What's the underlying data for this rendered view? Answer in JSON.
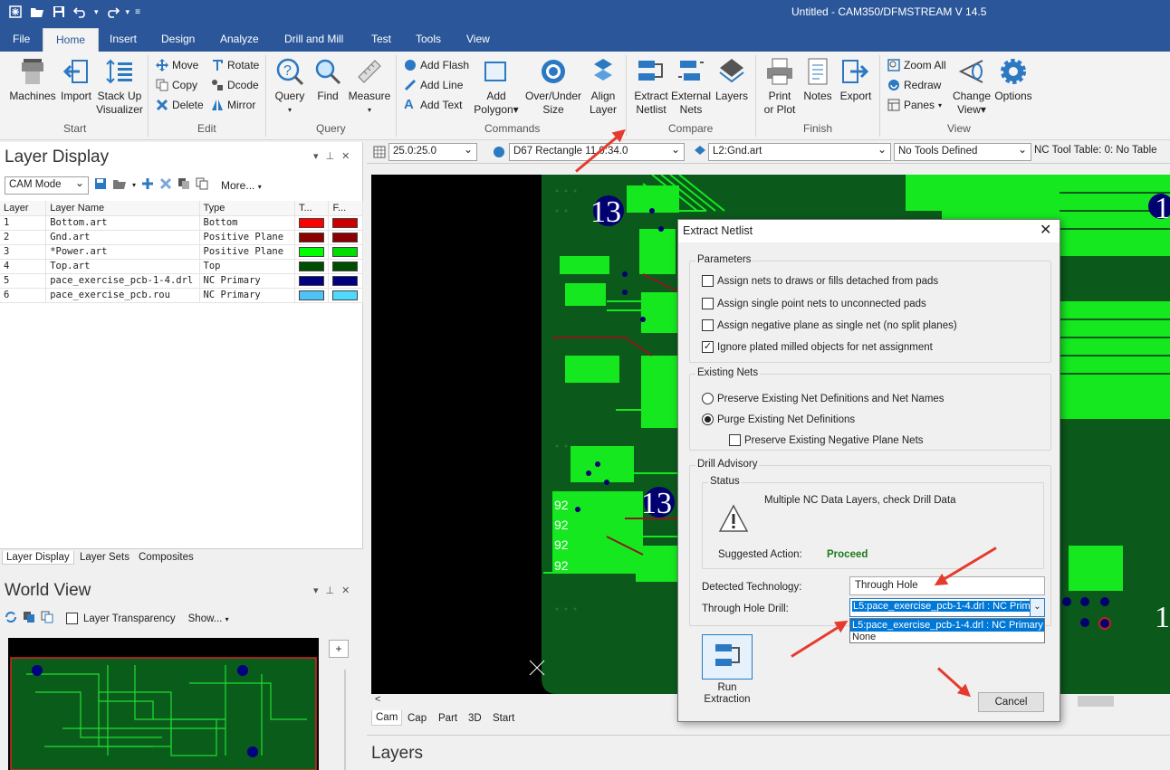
{
  "window": {
    "title": "Untitled - CAM350/DFMSTREAM V 14.5"
  },
  "menu": {
    "tabs": [
      "File",
      "Home",
      "Insert",
      "Design",
      "Analyze",
      "Drill and Mill",
      "Test",
      "Tools",
      "View"
    ],
    "active": "Home"
  },
  "ribbon": {
    "start": {
      "group": "Start",
      "machines": "Machines",
      "import": "Import",
      "stackup_1": "Stack Up",
      "stackup_2": "Visualizer"
    },
    "edit": {
      "group": "Edit",
      "move": "Move",
      "rotate": "Rotate",
      "copy": "Copy",
      "dcode": "Dcode",
      "delete": "Delete",
      "mirror": "Mirror"
    },
    "query": {
      "group": "Query",
      "query": "Query",
      "find": "Find",
      "measure": "Measure"
    },
    "commands": {
      "group": "Commands",
      "add_flash": "Add Flash",
      "add_line": "Add Line",
      "add_text": "Add Text",
      "add_polygon_1": "Add",
      "add_polygon_2": "Polygon",
      "over_under_1": "Over/Under",
      "over_under_2": "Size",
      "align_1": "Align",
      "align_2": "Layer"
    },
    "compare": {
      "group": "Compare",
      "extract_1": "Extract",
      "extract_2": "Netlist",
      "external_1": "External",
      "external_2": "Nets",
      "layers": "Layers"
    },
    "finish": {
      "group": "Finish",
      "print_1": "Print",
      "print_2": "or Plot",
      "notes": "Notes",
      "export": "Export"
    },
    "view": {
      "group": "View",
      "zoom_all": "Zoom All",
      "redraw": "Redraw",
      "panes": "Panes",
      "change_view_1": "Change",
      "change_view_2": "View",
      "options": "Options"
    }
  },
  "layer_display": {
    "title": "Layer Display",
    "mode": "CAM Mode",
    "more": "More...",
    "columns": [
      "Layer",
      "Layer Name",
      "Type",
      "T...",
      "F..."
    ],
    "rows": [
      {
        "num": "1",
        "name": "Bottom.art",
        "type": "Bottom",
        "t": "#ff0000",
        "f": "#cc0000"
      },
      {
        "num": "2",
        "name": "Gnd.art",
        "type": "Positive Plane",
        "t": "#8b0000",
        "f": "#8b0000"
      },
      {
        "num": "3",
        "name": "*Power.art",
        "type": "Positive Plane",
        "t": "#00ff00",
        "f": "#00dd00"
      },
      {
        "num": "4",
        "name": "Top.art",
        "type": "Top",
        "t": "#004d00",
        "f": "#004d00"
      },
      {
        "num": "5",
        "name": "pace_exercise_pcb-1-4.drl",
        "type": "NC Primary",
        "t": "#000080",
        "f": "#000080"
      },
      {
        "num": "6",
        "name": "pace_exercise_pcb.rou",
        "type": "NC Primary",
        "t": "#4fc3f7",
        "f": "#4fd9ff"
      }
    ],
    "tabs": [
      "Layer Display",
      "Layer Sets",
      "Composites"
    ]
  },
  "world_view": {
    "title": "World View",
    "transparency": "Layer Transparency",
    "show": "Show..."
  },
  "layers_panel": {
    "title": "Layers"
  },
  "toolbar": {
    "grid": "25.0:25.0",
    "dcode": "D67   Rectangle 11.0:34.0",
    "layer": "L2:Gnd.art",
    "tools": "No Tools Defined",
    "nc_table": "NC Tool Table: 0: No Table"
  },
  "canvas_tabs": [
    "Cam",
    "Cap",
    "Part",
    "3D",
    "Start"
  ],
  "canvas_labels": {
    "l13": "13",
    "n92": "92",
    "l1": "1"
  },
  "dialog": {
    "title": "Extract Netlist",
    "parameters": {
      "label": "Parameters",
      "opts": [
        {
          "text": "Assign nets to draws or fills detached from pads",
          "checked": false
        },
        {
          "text": "Assign single point nets to unconnected pads",
          "checked": false
        },
        {
          "text": "Assign negative plane as single net (no split planes)",
          "checked": false
        },
        {
          "text": "Ignore plated milled objects for net assignment",
          "checked": true
        }
      ]
    },
    "existing": {
      "label": "Existing Nets",
      "preserve": "Preserve Existing Net Definitions and Net Names",
      "purge": "Purge Existing Net Definitions",
      "neg": "Preserve Existing Negative Plane Nets"
    },
    "drill": {
      "label": "Drill Advisory",
      "status": "Status",
      "message": "Multiple NC Data Layers, check Drill Data",
      "suggested": "Suggested Action:",
      "action": "Proceed",
      "detected_label": "Detected Technology:",
      "detected": "Through Hole",
      "th_label": "Through Hole Drill:",
      "th_value": "L5:pace_exercise_pcb-1-4.drl  : NC Prim",
      "options": [
        "L5:pace_exercise_pcb-1-4.drl  : NC Primary",
        "None"
      ]
    },
    "run_1": "Run",
    "run_2": "Extraction",
    "cancel": "Cancel"
  }
}
